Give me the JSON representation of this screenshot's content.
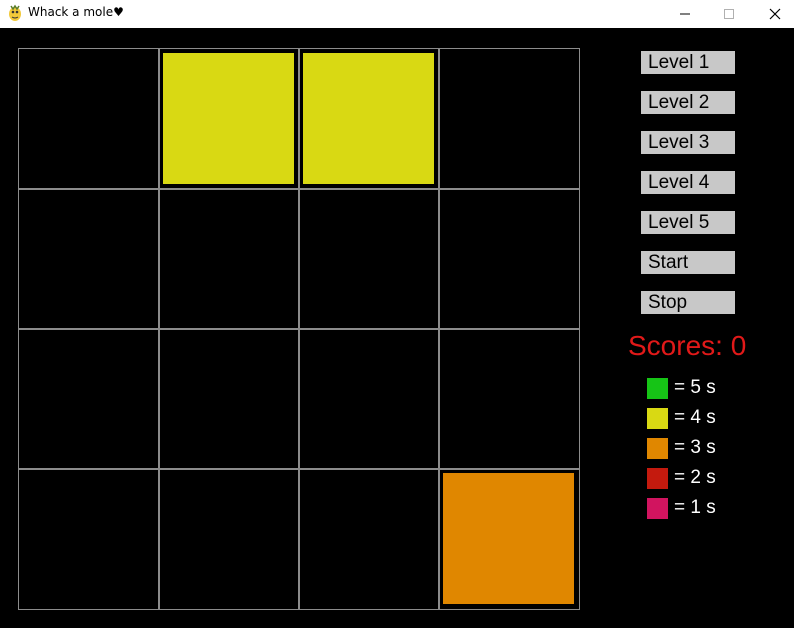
{
  "window": {
    "title": "Whack a mole♥",
    "minimize_icon": "minimize-icon",
    "maximize_icon": "maximize-icon",
    "close_icon": "close-icon"
  },
  "grid": {
    "rows": 4,
    "cols": 4,
    "line_color": "#8c8c8c",
    "moles": [
      {
        "row": 0,
        "col": 1,
        "color": "#d9d913"
      },
      {
        "row": 0,
        "col": 2,
        "color": "#d9d913"
      },
      {
        "row": 3,
        "col": 3,
        "color": "#e08700"
      }
    ]
  },
  "sidebar": {
    "buttons": [
      {
        "label": "Level 1"
      },
      {
        "label": "Level 2"
      },
      {
        "label": "Level 3"
      },
      {
        "label": "Level 4"
      },
      {
        "label": "Level 5"
      },
      {
        "label": "Start"
      },
      {
        "label": "Stop"
      }
    ],
    "score_text": "Scores: 0",
    "score_color": "#e11919",
    "legend": [
      {
        "color": "#16c416",
        "text": "= 5 s"
      },
      {
        "color": "#d9d913",
        "text": "= 4 s"
      },
      {
        "color": "#e08700",
        "text": "= 3 s"
      },
      {
        "color": "#c41a0e",
        "text": "= 2 s"
      },
      {
        "color": "#d1145f",
        "text": "= 1 s"
      }
    ]
  }
}
